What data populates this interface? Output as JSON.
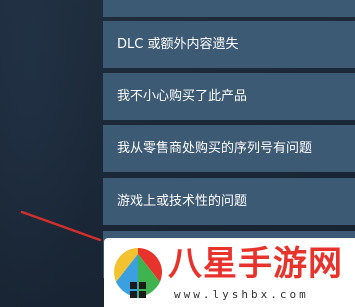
{
  "help_menu": {
    "items": [
      {
        "label": ""
      },
      {
        "label": "DLC 或额外内容遗失"
      },
      {
        "label": "我不小心购买了此产品"
      },
      {
        "label": "我从零售商处购买的序列号有问题"
      },
      {
        "label": "游戏上或技术性的问题"
      },
      {
        "label": ""
      }
    ]
  },
  "watermark": {
    "site_name": "八星手游网",
    "url": "www.lyshbx.com"
  },
  "colors": {
    "background": "#1b2838",
    "menu_item": "#3d5a74",
    "arrow": "#d0302c",
    "watermark_red": "#e8332d"
  }
}
